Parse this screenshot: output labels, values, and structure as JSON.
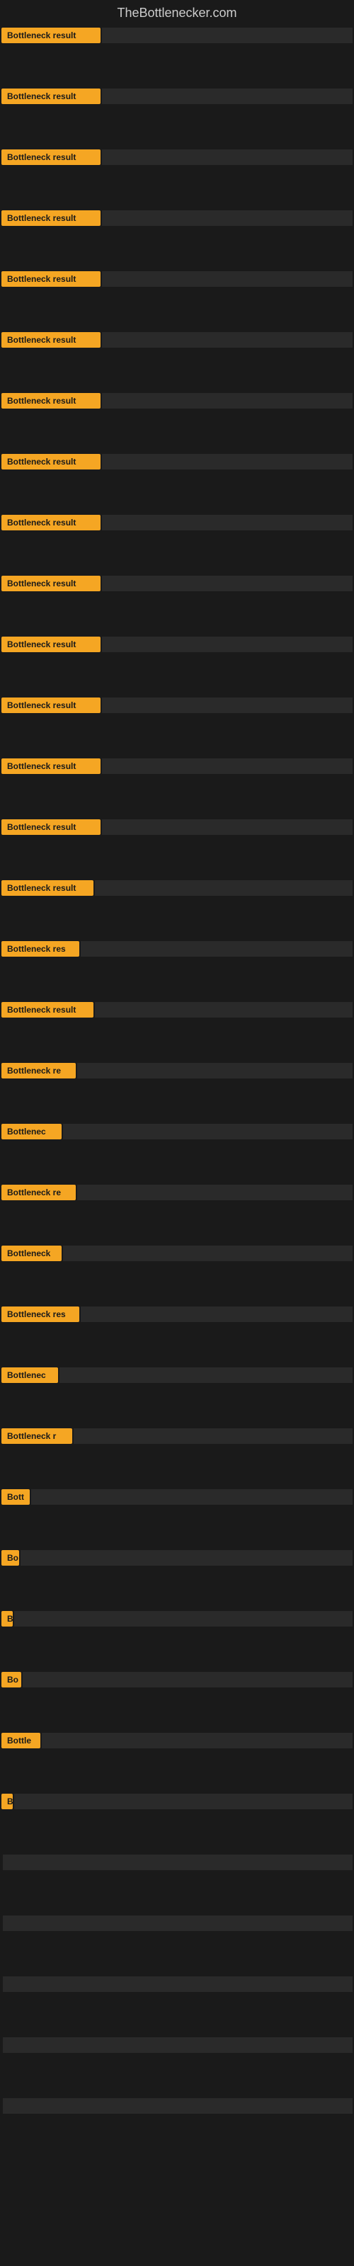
{
  "site_title": "TheBottlenecker.com",
  "rows": [
    {
      "badge_text": "Bottleneck result",
      "badge_width": 140,
      "bar_width_pct": 70
    },
    {
      "badge_text": "Bottleneck result",
      "badge_width": 140,
      "bar_width_pct": 70
    },
    {
      "badge_text": "Bottleneck result",
      "badge_width": 140,
      "bar_width_pct": 70
    },
    {
      "badge_text": "Bottleneck result",
      "badge_width": 140,
      "bar_width_pct": 70
    },
    {
      "badge_text": "Bottleneck result",
      "badge_width": 140,
      "bar_width_pct": 70
    },
    {
      "badge_text": "Bottleneck result",
      "badge_width": 140,
      "bar_width_pct": 70
    },
    {
      "badge_text": "Bottleneck result",
      "badge_width": 140,
      "bar_width_pct": 70
    },
    {
      "badge_text": "Bottleneck result",
      "badge_width": 140,
      "bar_width_pct": 70
    },
    {
      "badge_text": "Bottleneck result",
      "badge_width": 140,
      "bar_width_pct": 70
    },
    {
      "badge_text": "Bottleneck result",
      "badge_width": 140,
      "bar_width_pct": 70
    },
    {
      "badge_text": "Bottleneck result",
      "badge_width": 140,
      "bar_width_pct": 70
    },
    {
      "badge_text": "Bottleneck result",
      "badge_width": 140,
      "bar_width_pct": 70
    },
    {
      "badge_text": "Bottleneck result",
      "badge_width": 140,
      "bar_width_pct": 70
    },
    {
      "badge_text": "Bottleneck result",
      "badge_width": 140,
      "bar_width_pct": 70
    },
    {
      "badge_text": "Bottleneck result",
      "badge_width": 130,
      "bar_width_pct": 68
    },
    {
      "badge_text": "Bottleneck res",
      "badge_width": 110,
      "bar_width_pct": 65
    },
    {
      "badge_text": "Bottleneck result",
      "badge_width": 130,
      "bar_width_pct": 68
    },
    {
      "badge_text": "Bottleneck re",
      "badge_width": 105,
      "bar_width_pct": 62
    },
    {
      "badge_text": "Bottlenec",
      "badge_width": 85,
      "bar_width_pct": 58
    },
    {
      "badge_text": "Bottleneck re",
      "badge_width": 105,
      "bar_width_pct": 62
    },
    {
      "badge_text": "Bottleneck",
      "badge_width": 85,
      "bar_width_pct": 55
    },
    {
      "badge_text": "Bottleneck res",
      "badge_width": 110,
      "bar_width_pct": 60
    },
    {
      "badge_text": "Bottlenec",
      "badge_width": 80,
      "bar_width_pct": 52
    },
    {
      "badge_text": "Bottleneck r",
      "badge_width": 100,
      "bar_width_pct": 58
    },
    {
      "badge_text": "Bott",
      "badge_width": 40,
      "bar_width_pct": 45
    },
    {
      "badge_text": "Bo",
      "badge_width": 25,
      "bar_width_pct": 38
    },
    {
      "badge_text": "B",
      "badge_width": 14,
      "bar_width_pct": 30
    },
    {
      "badge_text": "Bo",
      "badge_width": 28,
      "bar_width_pct": 35
    },
    {
      "badge_text": "Bottle",
      "badge_width": 55,
      "bar_width_pct": 42
    },
    {
      "badge_text": "B",
      "badge_width": 12,
      "bar_width_pct": 25
    },
    {
      "badge_text": "",
      "badge_width": 0,
      "bar_width_pct": 0
    },
    {
      "badge_text": "",
      "badge_width": 0,
      "bar_width_pct": 0
    },
    {
      "badge_text": "",
      "badge_width": 0,
      "bar_width_pct": 0
    },
    {
      "badge_text": "",
      "badge_width": 0,
      "bar_width_pct": 0
    },
    {
      "badge_text": "",
      "badge_width": 0,
      "bar_width_pct": 0
    }
  ]
}
